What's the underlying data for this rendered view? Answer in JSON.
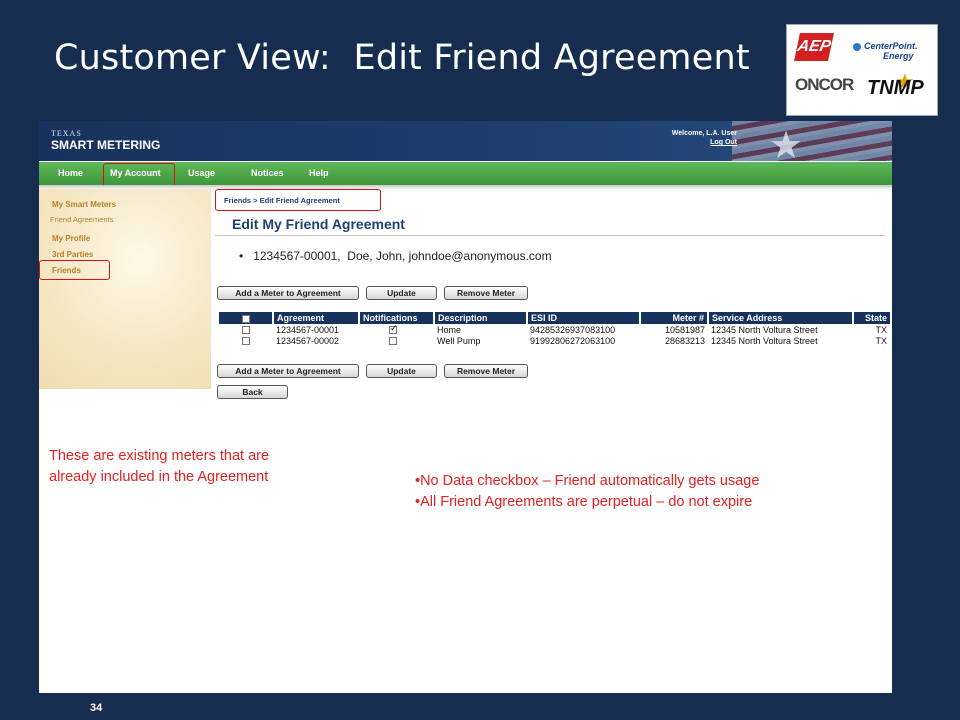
{
  "slide": {
    "title": "Customer View:  Edit Friend Agreement",
    "page_number": "34"
  },
  "logos": {
    "aep": "AEP",
    "centerpoint_line1": "CenterPoint.",
    "centerpoint_line2": "Energy",
    "oncor": "ONCOR",
    "tnmp": "TNMP"
  },
  "header": {
    "brand_small": "TEXAS",
    "brand_large": "SMART METERING",
    "welcome": "Welcome, L.A. User",
    "logout": "Log Out"
  },
  "nav": {
    "items": [
      "Home",
      "My Account",
      "Usage",
      "Notices",
      "Help"
    ],
    "active": "My Account"
  },
  "sidebar": {
    "items": [
      "My Smart Meters",
      "Friend Agreements",
      "My Profile",
      "3rd Parties",
      "Friends"
    ],
    "highlighted": "Friends"
  },
  "breadcrumb": "Friends > Edit Friend Agreement",
  "heading": "Edit My Friend Agreement",
  "agreement_summary": "1234567-00001,  Doe, John, johndoe@anonymous.com",
  "buttons": {
    "add_meter": "Add a Meter to Agreement",
    "update": "Update",
    "remove_meter": "Remove Meter",
    "back": "Back"
  },
  "table": {
    "columns": [
      "",
      "Agreement",
      "Notifications",
      "Description",
      "ESI ID",
      "Meter #",
      "Service Address",
      "State"
    ],
    "rows": [
      {
        "selected": false,
        "agreement": "1234567-00001",
        "notifications": true,
        "description": "Home",
        "esi_id": "94285326937083100",
        "meter": "10581987",
        "address": "12345 North Voltura Street",
        "state": "TX"
      },
      {
        "selected": false,
        "agreement": "1234567-00002",
        "notifications": false,
        "description": "Well Pump",
        "esi_id": "91992806272063100",
        "meter": "28683213",
        "address": "12345 North Voltura Street",
        "state": "TX"
      }
    ]
  },
  "notes": {
    "left": "These are existing meters that are already included in the Agreement",
    "right": [
      "•No Data checkbox – Friend automatically gets usage",
      "•All Friend Agreements are perpetual – do not expire"
    ]
  },
  "colors": {
    "slide_background": "#162d4f",
    "nav_green": "#4aa645",
    "table_header": "#17325c",
    "annotation_red": "#e62020",
    "highlight_red": "#dd1111"
  }
}
